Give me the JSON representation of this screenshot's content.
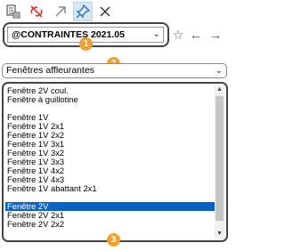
{
  "toolbar": {
    "icons": [
      "list-properties-icon",
      "link-break-icon",
      "arrow-up-right-icon",
      "pin-icon",
      "close-icon"
    ]
  },
  "constraint_set": {
    "value": "@CONTRAINTES 2021.05"
  },
  "category": {
    "value": "Fenêtres affleurantes"
  },
  "list": {
    "items": [
      "Fenêtre 2V coul.",
      "Fenêtre à guillotine",
      "",
      "Fenêtre 1V",
      "Fenêtre 1V 2x1",
      "Fenêtre 1V 2x2",
      "Fenêtre 1V 3x1",
      "Fenêtre 1V 3x2",
      "Fenêtre 1V 3x3",
      "Fenêtre 1V 4x2",
      "Fenêtre 1V 4x3",
      "Fenêtre 1V abattant 2x1",
      "",
      "Fenêtre 2V",
      "Fenêtre 2V 2x1",
      "Fenêtre 2V 2x2"
    ],
    "selected": "Fenêtre 2V"
  },
  "badges": [
    "1",
    "2",
    "3"
  ],
  "colors": {
    "selection": "#0a64c8",
    "badge": "#f0a030",
    "pin_highlight": "#d6e8f7"
  }
}
